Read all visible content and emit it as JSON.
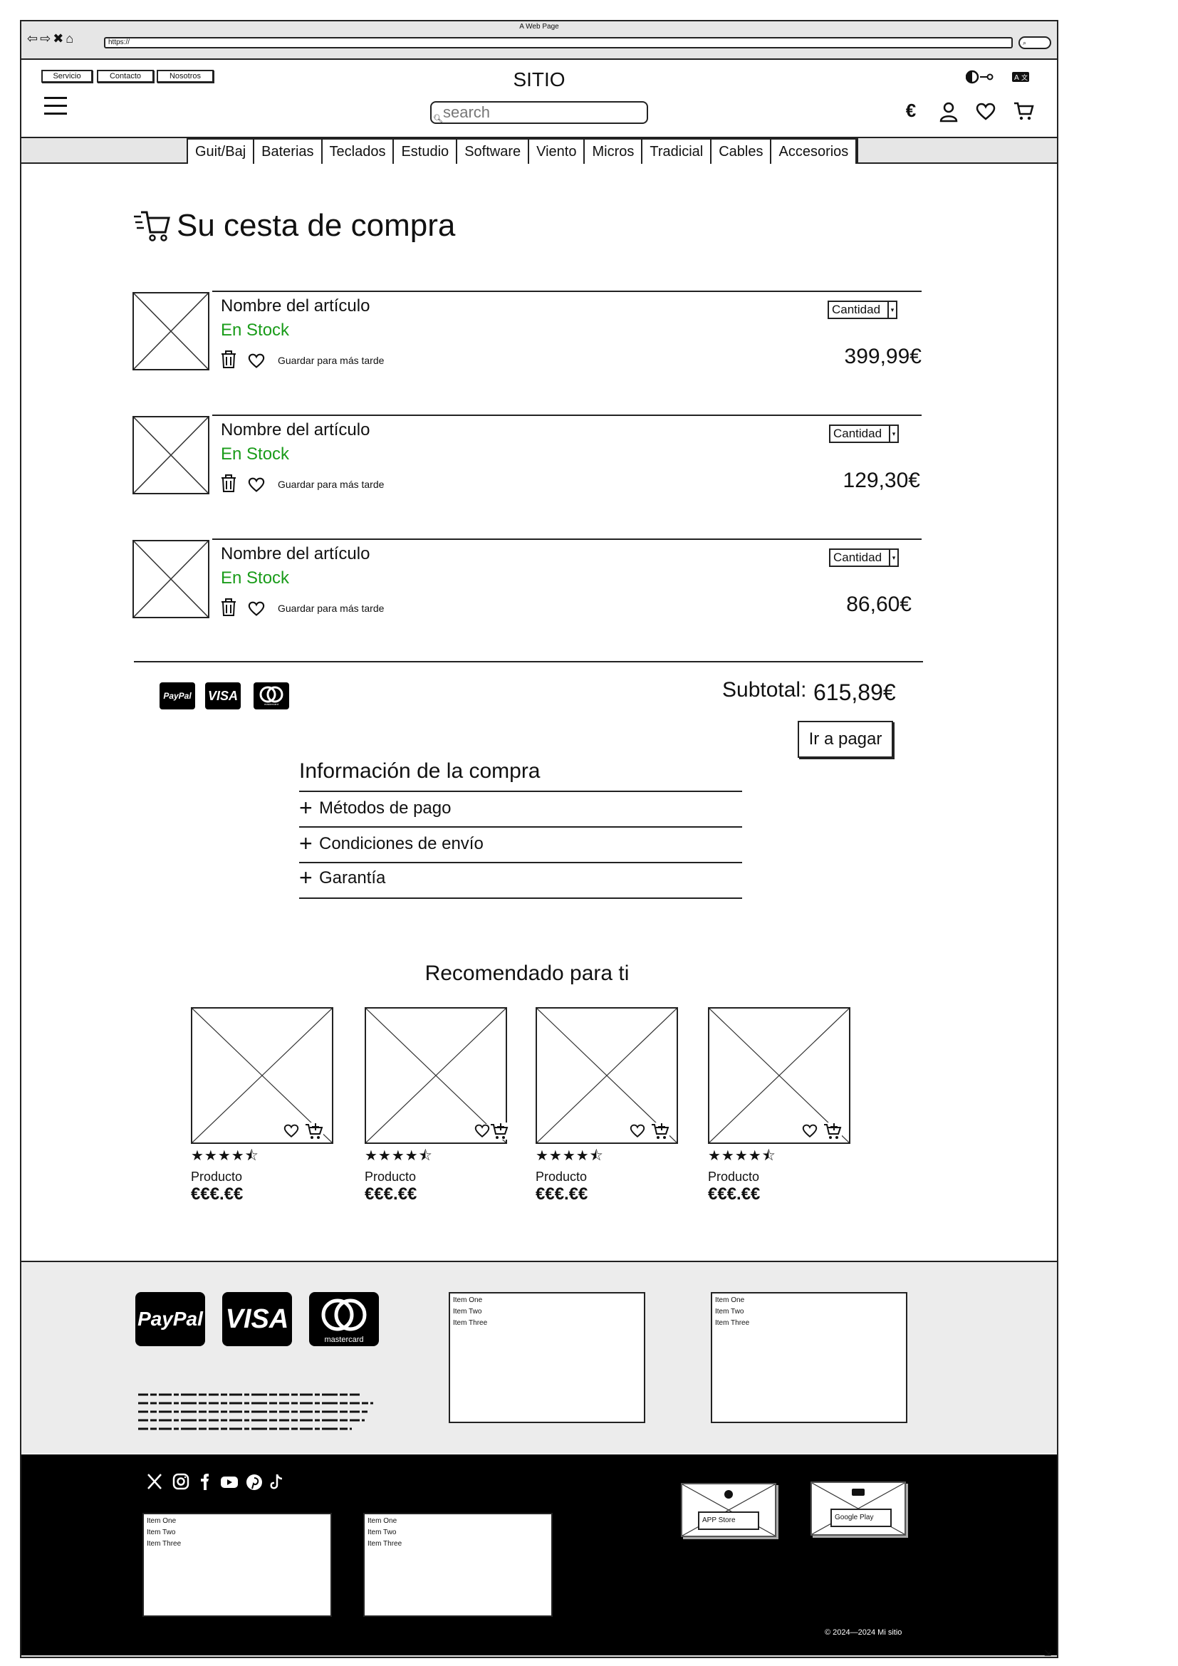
{
  "browser": {
    "window_title": "A Web Page",
    "url": "https://"
  },
  "header": {
    "top_links": [
      "Servicio",
      "Contacto",
      "Nosotros"
    ],
    "site_title": "SITIO",
    "search_placeholder": "search",
    "currency_symbol": "€",
    "icons": [
      "contrast-toggle-icon",
      "language-icon",
      "euro-icon",
      "user-icon",
      "heart-icon",
      "cart-icon"
    ]
  },
  "categories": [
    "Guit/Baj",
    "Baterias",
    "Teclados",
    "Estudio",
    "Software",
    "Viento",
    "Micros",
    "Tradicial",
    "Cables",
    "Accesorios"
  ],
  "cart": {
    "title": "Su cesta de compra",
    "items": [
      {
        "name": "Nombre del artículo",
        "stock": "En Stock",
        "save_label": "Guardar para más tarde",
        "quantity_label": "Cantidad",
        "price": "399,99€"
      },
      {
        "name": "Nombre del artículo",
        "stock": "En Stock",
        "save_label": "Guardar para más tarde",
        "quantity_label": "Cantidad",
        "price": "129,30€"
      },
      {
        "name": "Nombre del artículo",
        "stock": "En Stock",
        "save_label": "Guardar para más tarde",
        "quantity_label": "Cantidad",
        "price": "86,60€"
      }
    ],
    "payment_logos": [
      "PayPal",
      "VISA",
      "mastercard"
    ],
    "subtotal_label": "Subtotal:",
    "subtotal_value": "615,89€",
    "checkout_label": "Ir a pagar"
  },
  "info": {
    "title": "Información de la compra",
    "sections": [
      "Métodos de pago",
      "Condiciones de envío",
      "Garantía"
    ]
  },
  "recommended": {
    "title": "Recomendado para ti",
    "products": [
      {
        "name": "Producto",
        "price": "€€€.€€",
        "rating": 4.5
      },
      {
        "name": "Producto",
        "price": "€€€.€€",
        "rating": 4.5
      },
      {
        "name": "Producto",
        "price": "€€€.€€",
        "rating": 4.5
      },
      {
        "name": "Producto",
        "price": "€€€.€€",
        "rating": 4.5
      }
    ]
  },
  "footer": {
    "payment_logos": [
      "PayPal",
      "VISA",
      "mastercard"
    ],
    "lists": [
      [
        "Item One",
        "Item Two",
        "Item Three"
      ],
      [
        "Item One",
        "Item Two",
        "Item Three"
      ],
      [
        "Item One",
        "Item Two",
        "Item Three"
      ],
      [
        "Item One",
        "Item Two",
        "Item Three"
      ]
    ],
    "social_icons": [
      "x-icon",
      "instagram-icon",
      "facebook-icon",
      "youtube-icon",
      "pinterest-icon",
      "tiktok-icon"
    ],
    "app_store_label": "APP Store",
    "google_play_label": "Google Play",
    "copyright": "© 2024—2024 Mi sitio"
  }
}
